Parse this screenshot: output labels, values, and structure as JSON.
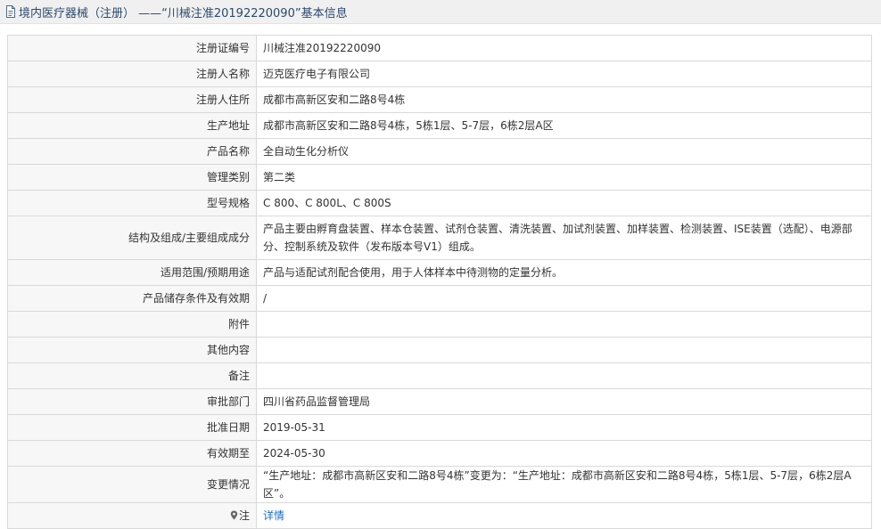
{
  "header": {
    "title": "境内医疗器械（注册） ——“川械注准20192220090”基本信息",
    "icon": "document-icon"
  },
  "rows": [
    {
      "label": "注册证编号",
      "value": "川械注准20192220090"
    },
    {
      "label": "注册人名称",
      "value": "迈克医疗电子有限公司"
    },
    {
      "label": "注册人住所",
      "value": "成都市高新区安和二路8号4栋"
    },
    {
      "label": "生产地址",
      "value": "成都市高新区安和二路8号4栋，5栋1层、5-7层，6栋2层A区"
    },
    {
      "label": "产品名称",
      "value": "全自动生化分析仪"
    },
    {
      "label": "管理类别",
      "value": "第二类"
    },
    {
      "label": "型号规格",
      "value": "C 800、C 800L、C 800S"
    },
    {
      "label": "结构及组成/主要组成成分",
      "value": "产品主要由孵育盘装置、样本仓装置、试剂仓装置、清洗装置、加试剂装置、加样装置、检测装置、ISE装置（选配）、电源部分、控制系统及软件（发布版本号V1）组成。"
    },
    {
      "label": "适用范围/预期用途",
      "value": "产品与适配试剂配合使用，用于人体样本中待测物的定量分析。"
    },
    {
      "label": "产品储存条件及有效期",
      "value": "/"
    },
    {
      "label": "附件",
      "value": ""
    },
    {
      "label": "其他内容",
      "value": ""
    },
    {
      "label": "备注",
      "value": ""
    },
    {
      "label": "审批部门",
      "value": "四川省药品监督管理局"
    },
    {
      "label": "批准日期",
      "value": "2019-05-31"
    },
    {
      "label": "有效期至",
      "value": "2024-05-30"
    },
    {
      "label": "变更情况",
      "value": "“生产地址：成都市高新区安和二路8号4栋”变更为：“生产地址：成都市高新区安和二路8号4栋，5栋1层、5-7层，6栋2层A区”。"
    }
  ],
  "note": {
    "label": "注",
    "icon": "pin-icon",
    "link_text": "详情"
  },
  "colors": {
    "header_bg": "#f0f0f0",
    "title_text": "#2b4a6d",
    "label_bg": "#f7f7f7",
    "border": "#d9d9d9",
    "link": "#1a6fc9"
  }
}
